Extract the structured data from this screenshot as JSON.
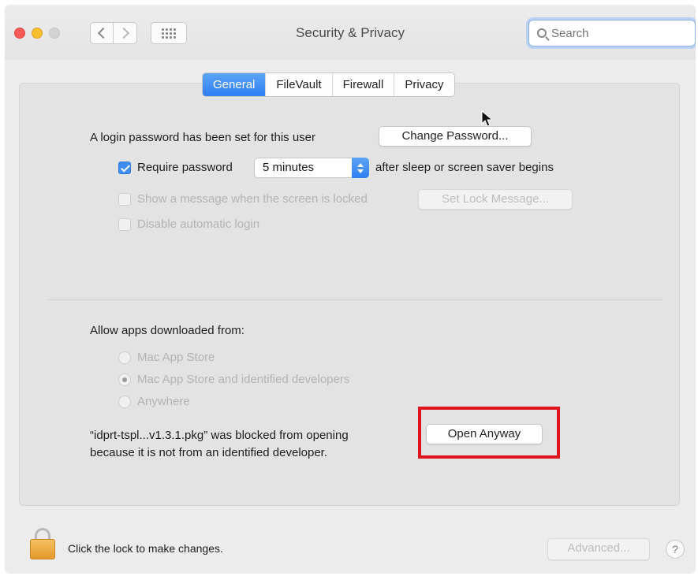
{
  "window": {
    "title": "Security & Privacy",
    "search_placeholder": "Search"
  },
  "tabs": [
    {
      "label": "General",
      "active": true
    },
    {
      "label": "FileVault",
      "active": false
    },
    {
      "label": "Firewall",
      "active": false
    },
    {
      "label": "Privacy",
      "active": false
    }
  ],
  "login": {
    "password_text": "A login password has been set for this user",
    "change_password_label": "Change Password...",
    "require_password_label": "Require password",
    "require_password_checked": true,
    "require_password_delay": "5 minutes",
    "after_sleep_text": "after sleep or screen saver begins",
    "show_message_label": "Show a message when the screen is locked",
    "show_message_checked": false,
    "set_lock_message_label": "Set Lock Message...",
    "disable_auto_login_label": "Disable automatic login",
    "disable_auto_login_checked": false
  },
  "apps": {
    "heading": "Allow apps downloaded from:",
    "options": [
      {
        "label": "Mac App Store",
        "selected": false
      },
      {
        "label": "Mac App Store and identified developers",
        "selected": true
      },
      {
        "label": "Anywhere",
        "selected": false
      }
    ],
    "blocked_line1": "“idprt-tspl...v1.3.1.pkg” was blocked from opening",
    "blocked_line2": "because it is not from an identified developer.",
    "open_anyway_label": "Open Anyway"
  },
  "footer": {
    "lock_text": "Click the lock to make changes.",
    "advanced_label": "Advanced...",
    "help_label": "?"
  },
  "colors": {
    "accent": "#3f8df3",
    "highlight_box": "#e0141b",
    "lock": "#e9a640"
  }
}
